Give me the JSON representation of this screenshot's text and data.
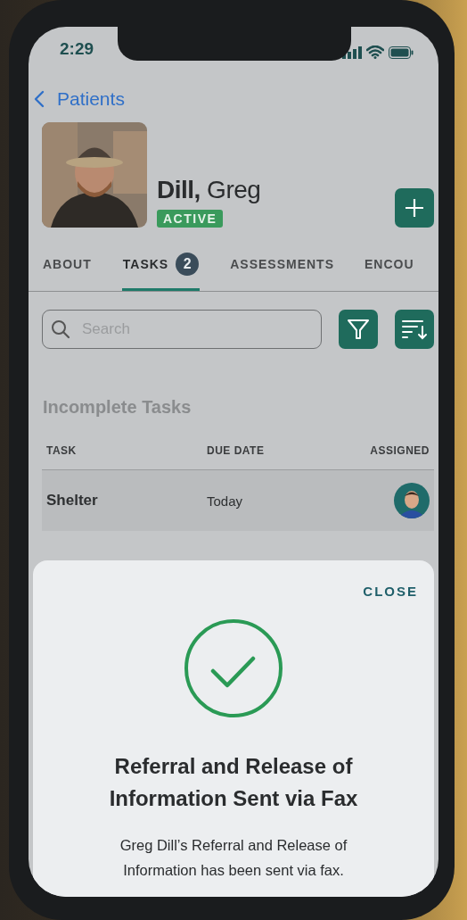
{
  "status_bar": {
    "time": "2:29"
  },
  "back_link": {
    "label": "Patients"
  },
  "patient": {
    "last_name": "Dill,",
    "first_name": "Greg",
    "status": "ACTIVE"
  },
  "tabs": [
    {
      "label": "ABOUT",
      "selected": false
    },
    {
      "label": "TASKS",
      "badge": "2",
      "selected": true
    },
    {
      "label": "ASSESSMENTS",
      "selected": false
    },
    {
      "label": "ENCOU",
      "selected": false
    }
  ],
  "search": {
    "placeholder": "Search"
  },
  "section_title": "Incomplete Tasks",
  "table": {
    "columns": [
      "TASK",
      "DUE DATE",
      "ASSIGNED"
    ],
    "rows": [
      {
        "task": "Shelter",
        "due_date": "Today"
      }
    ]
  },
  "modal": {
    "close_label": "CLOSE",
    "title": "Referral and Release of Information Sent via Fax",
    "message": "Greg Dill’s Referral and Release of Information has been sent via fax."
  }
}
